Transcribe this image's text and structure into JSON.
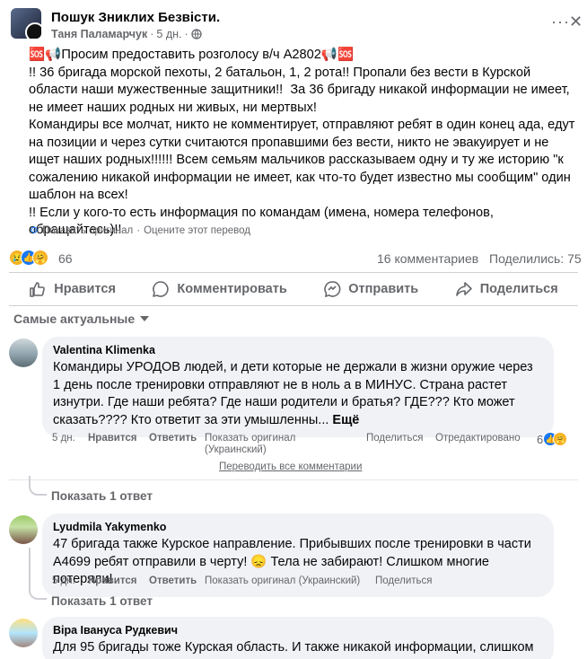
{
  "post": {
    "group_name": "Пошук Зниклих Безвісти.",
    "author": "Таня Паламарчук",
    "time": "5 дн.",
    "dot": "·",
    "text": "🆘📢Просим предоставить розголосу в/ч А2802📢🆘\n!! 36 бригада морской пехоты, 2 батальон, 1, 2 рота!! Пропали без вести в Курской области наши мужественные защитники!!  За 36 бригаду никакой информации не имеет, не имеет наших родных ни живых, ни мертвых!\nКомандиры все молчат, никто не комментирует, отправляют ребят в один конец ада, едут на позиции и через сутки считаются пропавшими без вести, никто не эвакуирует и не ищет наших родных!!!!!! Всем семьям мальчиков рассказываем одну и ту же историю \"к сожалению никакой информации не имеет, как что-то будет известно мы сообщим\" один шаблон на всех!\n!! Если у кого-то есть информация по командам (имена, номера телефонов, обращайтесь)!!",
    "show_original": "Показать оригинал",
    "rate_translation": "Оцените этот перевод",
    "reactions_count": "66",
    "comments_count": "16 комментариев",
    "shares_count": "Поделились: 75"
  },
  "actions": {
    "like": "Нравится",
    "comment": "Комментировать",
    "send": "Отправить",
    "share": "Поделиться"
  },
  "sort_label": "Самые актуальные",
  "comments": [
    {
      "name": "Valentina Klimenka",
      "text": "Командиры УРОДОВ людей, и дети которые не держали в жизни оружие через 1 день после тренировки отправляют не в ноль а в МИНУС. Страна растет изнутри. Где наши ребята? Где наши родители и братья? ГДЕ??? Кто может сказать???? Кто ответит за эти умышленны...",
      "more": "Ещё",
      "time": "5 дн.",
      "like": "Нравится",
      "reply": "Ответить",
      "show_original_line1": "Показать оригинал",
      "show_original_line2": "(Украинский)",
      "share": "Поделиться",
      "edited": "Отредактировано",
      "reactions": "6",
      "show_replies": "Показать 1 ответ"
    },
    {
      "name": "Lyudmila Yakymenko",
      "text": "47 бригада также Курское направление. Прибывших после тренировки в части А4699 ребят отправили в черту! 😞 Тела не забирают! Слишком многие потеряли!",
      "time": "5 дн.",
      "like": "Нравится",
      "reply": "Ответить",
      "show_original": "Показать оригинал (Украинский)",
      "share": "Поделиться",
      "show_replies": "Показать 1 ответ"
    },
    {
      "name": "Віра Івануса Рудкевич",
      "text": "Для 95 бригады тоже Курская область. И также никакой информации, слишком"
    }
  ],
  "translate_all": "Переводить все комментарии",
  "colors": {
    "accent": "#1877f2",
    "muted": "#65676b",
    "bubble": "#f0f2f5"
  }
}
